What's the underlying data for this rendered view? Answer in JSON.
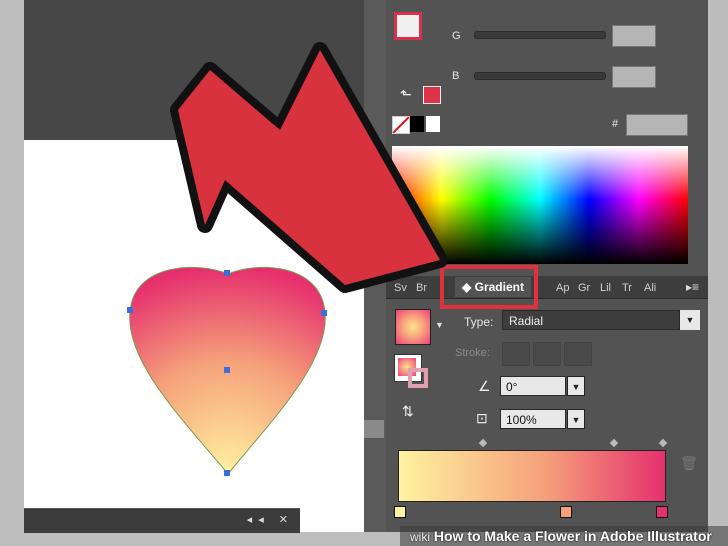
{
  "color_panel": {
    "g_label": "G",
    "b_label": "B",
    "hex_label": "#",
    "stroke_color": "#e0314a",
    "spectrum": "color-spectrum"
  },
  "tabs": {
    "items": [
      "Sv",
      "Br",
      "Gradient",
      "Ap",
      "Gr",
      "Lil",
      "Tr",
      "Ali"
    ],
    "active": "Gradient"
  },
  "gradient_panel": {
    "type_label": "Type:",
    "type_value": "Radial",
    "stroke_label": "Stroke:",
    "angle_value": "0°",
    "aspect_value": "100%"
  },
  "dock": {
    "collapse": "◂◂",
    "close": "✕"
  },
  "caption": {
    "wiki": "wiki",
    "how": "How to Make a Flower in Adobe Illustrator"
  },
  "colors": {
    "arrow_fill": "#d9323f",
    "highlight_box": "#e0323e",
    "panel_bg": "#535353",
    "gradient_start": "#fff2a0",
    "gradient_end": "#e6306e"
  }
}
